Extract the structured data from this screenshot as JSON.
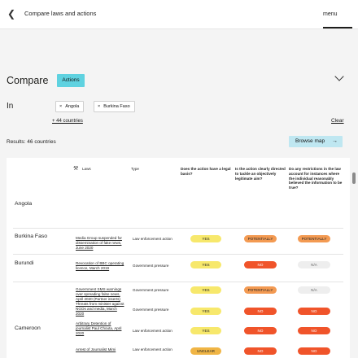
{
  "header": {
    "title": "Compare laws and actions",
    "menu_label": "menu"
  },
  "icons": {
    "back": "chevron-left-icon",
    "collapse": "chevron-down-icon",
    "remove": "close-icon",
    "laws": "gavel-icon",
    "browse": "arrow-right-icon"
  },
  "compare": {
    "label": "Compare",
    "tag": "Actions"
  },
  "filter": {
    "in_label": "In",
    "chips": [
      "Angola",
      "Burkina Faso"
    ],
    "chip_remove_glyph": "×",
    "more_link": "+ 44 countries",
    "clear_label": "Clear"
  },
  "results": {
    "label": "Results: 46 countries",
    "browse_label": "Browse map",
    "browse_arrow": "→"
  },
  "colors": {
    "accent": "#5fd2e0",
    "yes": "#f7e86c",
    "potentially": "#f39a52",
    "no": "#f0542a",
    "na": "#eeeeee",
    "unclear": "#f0b545"
  },
  "table": {
    "headers": {
      "laws": "Laws",
      "type": "Type",
      "q1": "Does the action have a legal basis?",
      "q2": "Is the action clearly directed to tackle an objectively legitimate aim?",
      "q3": "Do any restrictions in the law account for instances where the individual reasonably believed the information to be true?"
    },
    "countries": [
      "Angola",
      "Burkina Faso",
      "Burundi",
      "Cameroon"
    ],
    "rows": [
      {
        "law": "Media Group suspended for dissemination of fake news, June 2020",
        "type": "Law enforcement action",
        "q1": "YES",
        "q2": "POTENTIALLY",
        "q3": "POTENTIALLY"
      },
      {
        "law": "Revocation of BBC operating licence, March 2019",
        "type": "Government pressure",
        "q1": "YES",
        "q2": "NO",
        "q3": "N/A"
      },
      {
        "law": "Government SMS warnings over spreading false news, April 2020 (Partner inserts)",
        "type": "Government pressure",
        "q1": "YES",
        "q2": "POTENTIALLY",
        "q3": "N/A"
      },
      {
        "law": "Threats from minister against NGOs and media, March 2020",
        "type": "Government pressure",
        "q1": "YES",
        "q2": "NO",
        "q3": "NO"
      },
      {
        "law": "Arbitrary Detention of journalist Paul Chouta, April 2020",
        "type": "Law enforcement action",
        "q1": "YES",
        "q2": "NO",
        "q3": "NO"
      },
      {
        "law": "Arrest of Journalist Mimi",
        "type": "Law enforcement action",
        "q1": "UNCLEAR",
        "q2": "NO",
        "q3": "NO"
      }
    ]
  }
}
